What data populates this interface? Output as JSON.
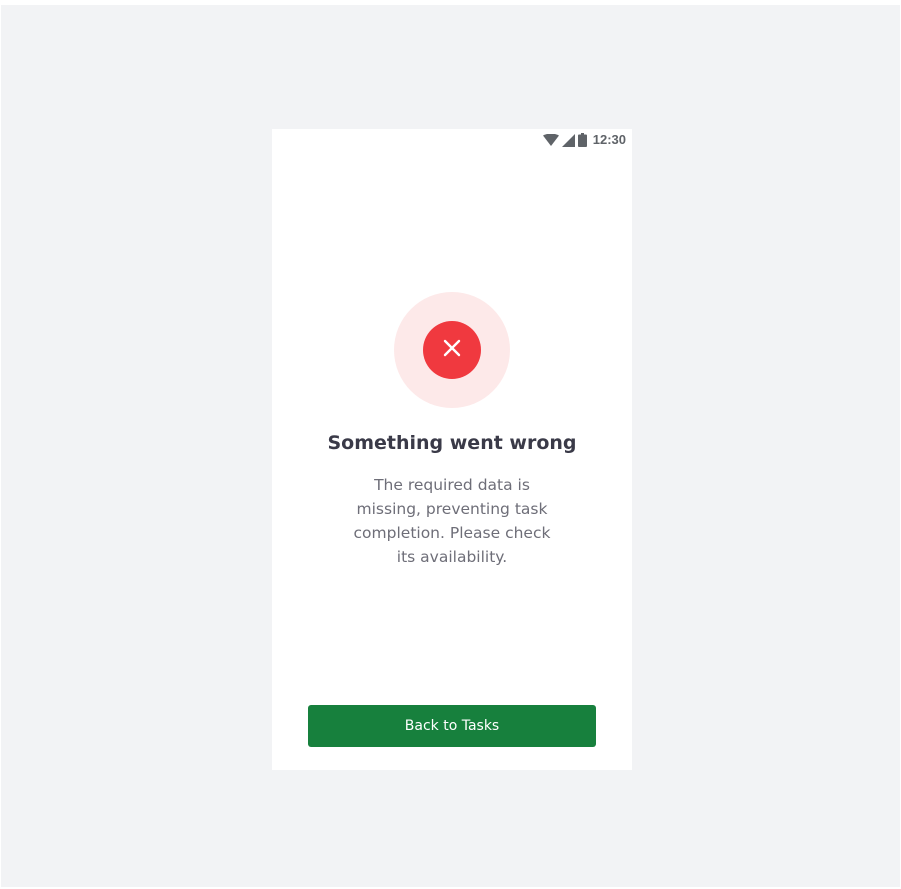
{
  "status_bar": {
    "time": "12:30",
    "icons": [
      "wifi-icon",
      "cellular-signal-icon",
      "battery-icon"
    ]
  },
  "error": {
    "icon": "close-x-icon",
    "title": "Something went wrong",
    "message": "The required data is missing, preventing task completion. Please check its availability."
  },
  "actions": {
    "back_label": "Back to Tasks"
  },
  "colors": {
    "background": "#f2f3f5",
    "error_red": "#f0393f",
    "error_halo": "#fde9e9",
    "primary_green": "#17803d",
    "title_text": "#3a3a48",
    "body_text": "#6e6e78"
  }
}
